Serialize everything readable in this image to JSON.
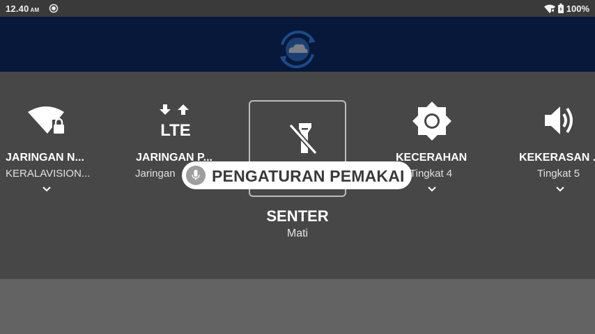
{
  "status_bar": {
    "time": "12.40",
    "ampm": "AM",
    "battery_text": "100%"
  },
  "tiles": [
    {
      "title": "JARINGAN N...",
      "subtitle": "KERALAVISION...",
      "icon": "wifi-lock-icon"
    },
    {
      "title": "JARINGAN P...",
      "subtitle": "Jaringan",
      "icon": "lte-icon"
    },
    {
      "title": "SENTER",
      "subtitle": "Mati",
      "icon": "flashlight-off-icon"
    },
    {
      "title": "KECERAHAN",
      "subtitle": "Tingkat 4",
      "icon": "brightness-icon"
    },
    {
      "title": "KEKERASAN ...",
      "subtitle": "Tingkat 5",
      "icon": "volume-icon"
    }
  ],
  "toast": {
    "label": "PENGATURAN PEMAKAI",
    "icon": "microphone-icon"
  },
  "colors": {
    "header": "#07183a",
    "panel": "#474747",
    "status_bar": "#3a3a3a"
  }
}
